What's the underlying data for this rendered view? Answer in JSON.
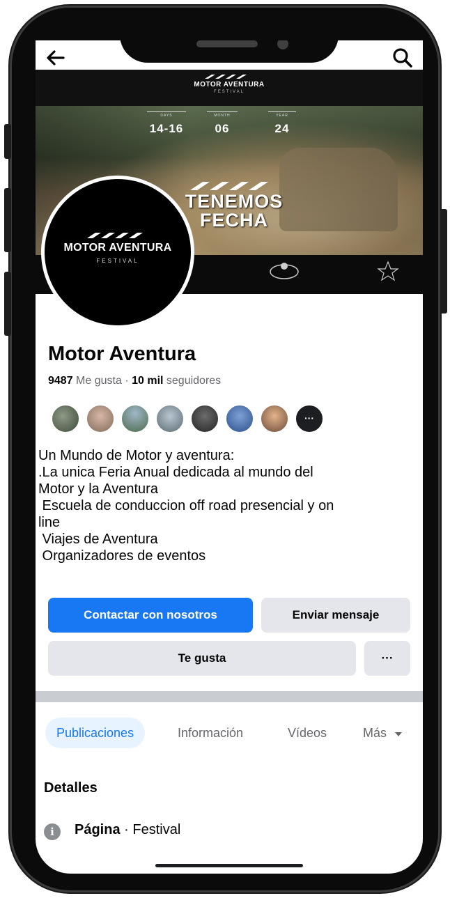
{
  "cover": {
    "brand": "MOTOR AVENTURA",
    "brand_sub": "FESTIVAL",
    "dates": [
      {
        "label": "DAYS",
        "value": "14-16"
      },
      {
        "label": "MONTH",
        "value": "06"
      },
      {
        "label": "YEAR",
        "value": "24"
      }
    ],
    "headline_line1": "TENEMOS",
    "headline_line2": "FECHA"
  },
  "avatar": {
    "brand": "MOTOR AVENTURA",
    "sub": "FESTIVAL"
  },
  "profile": {
    "name": "Motor Aventura",
    "likes_count": "9487",
    "likes_label": "Me gusta",
    "separator": "·",
    "followers_count": "10 mil",
    "followers_label": "seguidores",
    "friends_more": "···"
  },
  "bio": {
    "lines": [
      "Un Mundo de Motor y aventura:",
      ".La unica Feria Anual dedicada al mundo del",
      "Motor y la Aventura",
      " Escuela de conduccion off road presencial y on",
      "line",
      " Viajes de Aventura",
      " Organizadores de eventos"
    ]
  },
  "actions": {
    "contact": "Contactar con nosotros",
    "message": "Enviar mensaje",
    "like": "Te gusta",
    "more": "···"
  },
  "tabs": {
    "posts": "Publicaciones",
    "info": "Información",
    "videos": "Vídeos",
    "more": "Más"
  },
  "details": {
    "title": "Detalles",
    "row_bold": "Página",
    "row_rest": " · Festival"
  },
  "colors": {
    "accent": "#1877f2",
    "secondary_button": "#e4e6eb",
    "text": "#050505",
    "muted": "#65676b"
  }
}
